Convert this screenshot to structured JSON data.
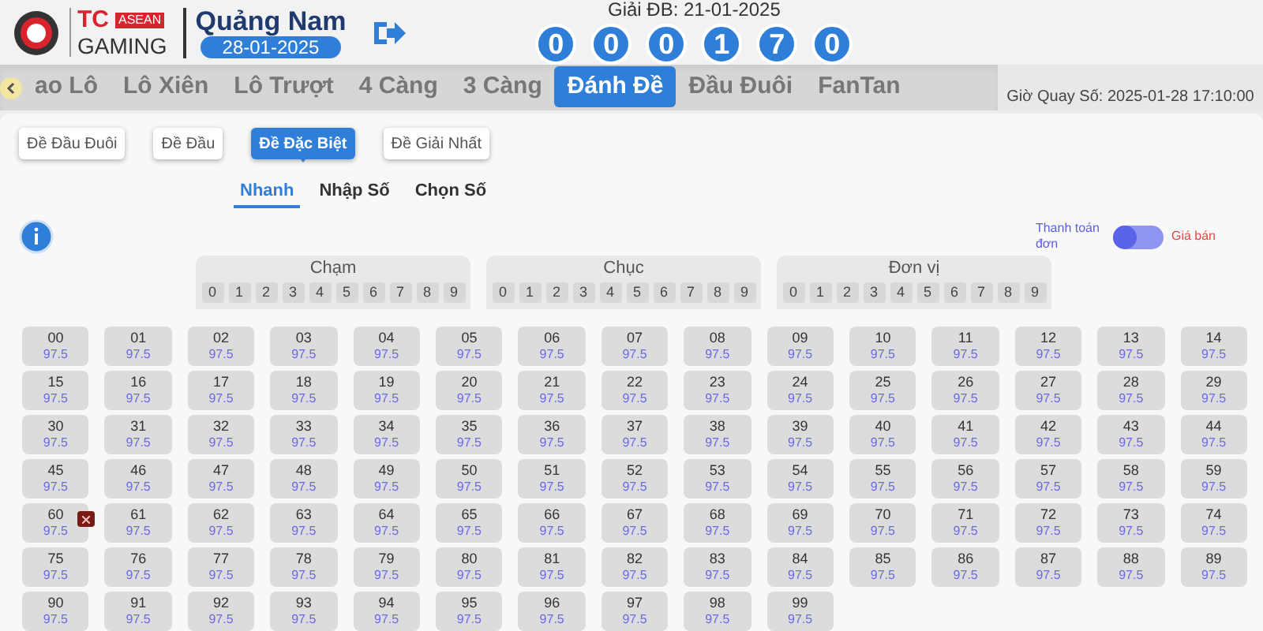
{
  "header": {
    "brand_top": "TC",
    "brand_badge": "ASEAN",
    "brand_bottom": "GAMING",
    "province": "Quảng Nam",
    "date": "28-01-2025",
    "result_label": "Giải ĐB: 21-01-2025",
    "result_digits": [
      "0",
      "0",
      "0",
      "1",
      "7",
      "0"
    ],
    "draw_time": "Giờ Quay Số: 2025-01-28 17:10:00"
  },
  "game_tabs": [
    {
      "label": "ao Lô",
      "selected": false
    },
    {
      "label": "Lô Xiên",
      "selected": false
    },
    {
      "label": "Lô Trượt",
      "selected": false
    },
    {
      "label": "4 Càng",
      "selected": false
    },
    {
      "label": "3 Càng",
      "selected": false
    },
    {
      "label": "Đánh Đề",
      "selected": true
    },
    {
      "label": "Đầu Đuôi",
      "selected": false
    },
    {
      "label": "FanTan",
      "selected": false
    }
  ],
  "bet_types": [
    {
      "label": "Đề Đầu Đuôi",
      "selected": false
    },
    {
      "label": "Đề Đầu",
      "selected": false
    },
    {
      "label": "Đề Đặc Biệt",
      "selected": true
    },
    {
      "label": "Đề Giải Nhất",
      "selected": false
    }
  ],
  "modes": [
    {
      "label": "Nhanh",
      "selected": true
    },
    {
      "label": "Nhập Số",
      "selected": false
    },
    {
      "label": "Chọn Số",
      "selected": false
    }
  ],
  "toggle": {
    "left_label": "Thanh toán đơn",
    "right_label": "Giá bán",
    "on": false
  },
  "groups": [
    {
      "title": "Chạm",
      "digits": [
        "0",
        "1",
        "2",
        "3",
        "4",
        "5",
        "6",
        "7",
        "8",
        "9"
      ]
    },
    {
      "title": "Chục",
      "digits": [
        "0",
        "1",
        "2",
        "3",
        "4",
        "5",
        "6",
        "7",
        "8",
        "9"
      ]
    },
    {
      "title": "Đơn vị",
      "digits": [
        "0",
        "1",
        "2",
        "3",
        "4",
        "5",
        "6",
        "7",
        "8",
        "9"
      ]
    }
  ],
  "cells": [
    {
      "number": "00",
      "odds": "97.5",
      "removable": false
    },
    {
      "number": "01",
      "odds": "97.5",
      "removable": false
    },
    {
      "number": "02",
      "odds": "97.5",
      "removable": false
    },
    {
      "number": "03",
      "odds": "97.5",
      "removable": false
    },
    {
      "number": "04",
      "odds": "97.5",
      "removable": false
    },
    {
      "number": "05",
      "odds": "97.5",
      "removable": false
    },
    {
      "number": "06",
      "odds": "97.5",
      "removable": false
    },
    {
      "number": "07",
      "odds": "97.5",
      "removable": false
    },
    {
      "number": "08",
      "odds": "97.5",
      "removable": false
    },
    {
      "number": "09",
      "odds": "97.5",
      "removable": false
    },
    {
      "number": "10",
      "odds": "97.5",
      "removable": false
    },
    {
      "number": "11",
      "odds": "97.5",
      "removable": false
    },
    {
      "number": "12",
      "odds": "97.5",
      "removable": false
    },
    {
      "number": "13",
      "odds": "97.5",
      "removable": false
    },
    {
      "number": "14",
      "odds": "97.5",
      "removable": false
    },
    {
      "number": "15",
      "odds": "97.5",
      "removable": false
    },
    {
      "number": "16",
      "odds": "97.5",
      "removable": false
    },
    {
      "number": "17",
      "odds": "97.5",
      "removable": false
    },
    {
      "number": "18",
      "odds": "97.5",
      "removable": false
    },
    {
      "number": "19",
      "odds": "97.5",
      "removable": false
    },
    {
      "number": "20",
      "odds": "97.5",
      "removable": false
    },
    {
      "number": "21",
      "odds": "97.5",
      "removable": false
    },
    {
      "number": "22",
      "odds": "97.5",
      "removable": false
    },
    {
      "number": "23",
      "odds": "97.5",
      "removable": false
    },
    {
      "number": "24",
      "odds": "97.5",
      "removable": false
    },
    {
      "number": "25",
      "odds": "97.5",
      "removable": false
    },
    {
      "number": "26",
      "odds": "97.5",
      "removable": false
    },
    {
      "number": "27",
      "odds": "97.5",
      "removable": false
    },
    {
      "number": "28",
      "odds": "97.5",
      "removable": false
    },
    {
      "number": "29",
      "odds": "97.5",
      "removable": false
    },
    {
      "number": "30",
      "odds": "97.5",
      "removable": false
    },
    {
      "number": "31",
      "odds": "97.5",
      "removable": false
    },
    {
      "number": "32",
      "odds": "97.5",
      "removable": false
    },
    {
      "number": "33",
      "odds": "97.5",
      "removable": false
    },
    {
      "number": "34",
      "odds": "97.5",
      "removable": false
    },
    {
      "number": "35",
      "odds": "97.5",
      "removable": false
    },
    {
      "number": "36",
      "odds": "97.5",
      "removable": false
    },
    {
      "number": "37",
      "odds": "97.5",
      "removable": false
    },
    {
      "number": "38",
      "odds": "97.5",
      "removable": false
    },
    {
      "number": "39",
      "odds": "97.5",
      "removable": false
    },
    {
      "number": "40",
      "odds": "97.5",
      "removable": false
    },
    {
      "number": "41",
      "odds": "97.5",
      "removable": false
    },
    {
      "number": "42",
      "odds": "97.5",
      "removable": false
    },
    {
      "number": "43",
      "odds": "97.5",
      "removable": false
    },
    {
      "number": "44",
      "odds": "97.5",
      "removable": false
    },
    {
      "number": "45",
      "odds": "97.5",
      "removable": false
    },
    {
      "number": "46",
      "odds": "97.5",
      "removable": false
    },
    {
      "number": "47",
      "odds": "97.5",
      "removable": false
    },
    {
      "number": "48",
      "odds": "97.5",
      "removable": false
    },
    {
      "number": "49",
      "odds": "97.5",
      "removable": false
    },
    {
      "number": "50",
      "odds": "97.5",
      "removable": false
    },
    {
      "number": "51",
      "odds": "97.5",
      "removable": false
    },
    {
      "number": "52",
      "odds": "97.5",
      "removable": false
    },
    {
      "number": "53",
      "odds": "97.5",
      "removable": false
    },
    {
      "number": "54",
      "odds": "97.5",
      "removable": false
    },
    {
      "number": "55",
      "odds": "97.5",
      "removable": false
    },
    {
      "number": "56",
      "odds": "97.5",
      "removable": false
    },
    {
      "number": "57",
      "odds": "97.5",
      "removable": false
    },
    {
      "number": "58",
      "odds": "97.5",
      "removable": false
    },
    {
      "number": "59",
      "odds": "97.5",
      "removable": false
    },
    {
      "number": "60",
      "odds": "97.5",
      "removable": true
    },
    {
      "number": "61",
      "odds": "97.5",
      "removable": false
    },
    {
      "number": "62",
      "odds": "97.5",
      "removable": false
    },
    {
      "number": "63",
      "odds": "97.5",
      "removable": false
    },
    {
      "number": "64",
      "odds": "97.5",
      "removable": false
    },
    {
      "number": "65",
      "odds": "97.5",
      "removable": false
    },
    {
      "number": "66",
      "odds": "97.5",
      "removable": false
    },
    {
      "number": "67",
      "odds": "97.5",
      "removable": false
    },
    {
      "number": "68",
      "odds": "97.5",
      "removable": false
    },
    {
      "number": "69",
      "odds": "97.5",
      "removable": false
    },
    {
      "number": "70",
      "odds": "97.5",
      "removable": false
    },
    {
      "number": "71",
      "odds": "97.5",
      "removable": false
    },
    {
      "number": "72",
      "odds": "97.5",
      "removable": false
    },
    {
      "number": "73",
      "odds": "97.5",
      "removable": false
    },
    {
      "number": "74",
      "odds": "97.5",
      "removable": false
    },
    {
      "number": "75",
      "odds": "97.5",
      "removable": false
    },
    {
      "number": "76",
      "odds": "97.5",
      "removable": false
    },
    {
      "number": "77",
      "odds": "97.5",
      "removable": false
    },
    {
      "number": "78",
      "odds": "97.5",
      "removable": false
    },
    {
      "number": "79",
      "odds": "97.5",
      "removable": false
    },
    {
      "number": "80",
      "odds": "97.5",
      "removable": false
    },
    {
      "number": "81",
      "odds": "97.5",
      "removable": false
    },
    {
      "number": "82",
      "odds": "97.5",
      "removable": false
    },
    {
      "number": "83",
      "odds": "97.5",
      "removable": false
    },
    {
      "number": "84",
      "odds": "97.5",
      "removable": false
    },
    {
      "number": "85",
      "odds": "97.5",
      "removable": false
    },
    {
      "number": "86",
      "odds": "97.5",
      "removable": false
    },
    {
      "number": "87",
      "odds": "97.5",
      "removable": false
    },
    {
      "number": "88",
      "odds": "97.5",
      "removable": false
    },
    {
      "number": "89",
      "odds": "97.5",
      "removable": false
    },
    {
      "number": "90",
      "odds": "97.5",
      "removable": false
    },
    {
      "number": "91",
      "odds": "97.5",
      "removable": false
    },
    {
      "number": "92",
      "odds": "97.5",
      "removable": false
    },
    {
      "number": "93",
      "odds": "97.5",
      "removable": false
    },
    {
      "number": "94",
      "odds": "97.5",
      "removable": false
    },
    {
      "number": "95",
      "odds": "97.5",
      "removable": false
    },
    {
      "number": "96",
      "odds": "97.5",
      "removable": false
    },
    {
      "number": "97",
      "odds": "97.5",
      "removable": false
    },
    {
      "number": "98",
      "odds": "97.5",
      "removable": false
    },
    {
      "number": "99",
      "odds": "97.5",
      "removable": false
    }
  ]
}
